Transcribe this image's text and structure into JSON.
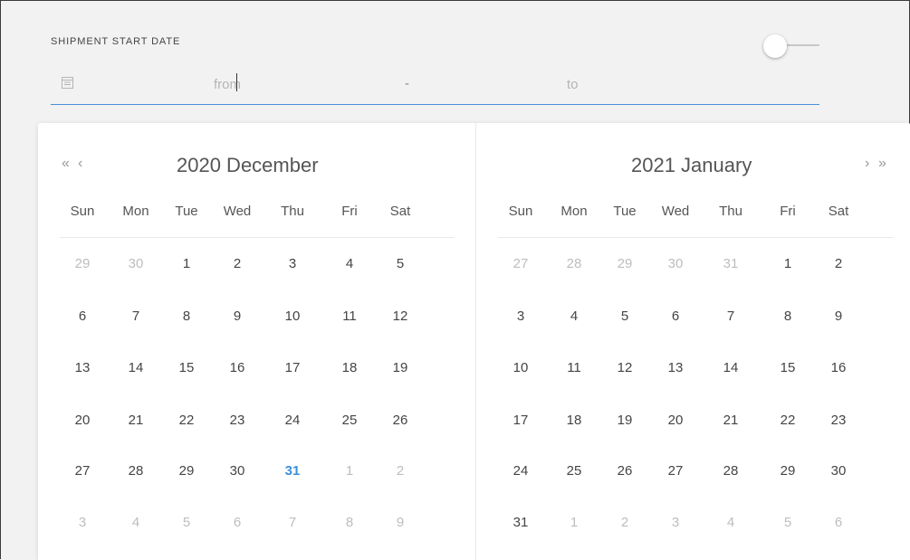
{
  "field": {
    "label": "SHIPMENT START DATE",
    "from_placeholder": "from",
    "separator": "-",
    "to_placeholder": "to"
  },
  "weekdays": [
    "Sun",
    "Mon",
    "Tue",
    "Wed",
    "Thu",
    "Fri",
    "Sat"
  ],
  "nav": {
    "prev_year": "«",
    "prev_month": "‹",
    "next_month": "›",
    "next_year": "»"
  },
  "calendars": [
    {
      "title": "2020 December",
      "weeks": [
        [
          {
            "d": "29",
            "m": true
          },
          {
            "d": "30",
            "m": true
          },
          {
            "d": "1"
          },
          {
            "d": "2"
          },
          {
            "d": "3"
          },
          {
            "d": "4"
          },
          {
            "d": "5"
          }
        ],
        [
          {
            "d": "6"
          },
          {
            "d": "7"
          },
          {
            "d": "8"
          },
          {
            "d": "9"
          },
          {
            "d": "10"
          },
          {
            "d": "11"
          },
          {
            "d": "12"
          }
        ],
        [
          {
            "d": "13"
          },
          {
            "d": "14"
          },
          {
            "d": "15"
          },
          {
            "d": "16"
          },
          {
            "d": "17"
          },
          {
            "d": "18"
          },
          {
            "d": "19"
          }
        ],
        [
          {
            "d": "20"
          },
          {
            "d": "21"
          },
          {
            "d": "22"
          },
          {
            "d": "23"
          },
          {
            "d": "24"
          },
          {
            "d": "25"
          },
          {
            "d": "26"
          }
        ],
        [
          {
            "d": "27"
          },
          {
            "d": "28"
          },
          {
            "d": "29"
          },
          {
            "d": "30"
          },
          {
            "d": "31",
            "t": true
          },
          {
            "d": "1",
            "m": true
          },
          {
            "d": "2",
            "m": true
          }
        ],
        [
          {
            "d": "3",
            "m": true
          },
          {
            "d": "4",
            "m": true
          },
          {
            "d": "5",
            "m": true
          },
          {
            "d": "6",
            "m": true
          },
          {
            "d": "7",
            "m": true
          },
          {
            "d": "8",
            "m": true
          },
          {
            "d": "9",
            "m": true
          }
        ]
      ]
    },
    {
      "title": "2021 January",
      "weeks": [
        [
          {
            "d": "27",
            "m": true
          },
          {
            "d": "28",
            "m": true
          },
          {
            "d": "29",
            "m": true
          },
          {
            "d": "30",
            "m": true
          },
          {
            "d": "31",
            "m": true
          },
          {
            "d": "1"
          },
          {
            "d": "2"
          }
        ],
        [
          {
            "d": "3"
          },
          {
            "d": "4"
          },
          {
            "d": "5"
          },
          {
            "d": "6"
          },
          {
            "d": "7"
          },
          {
            "d": "8"
          },
          {
            "d": "9"
          }
        ],
        [
          {
            "d": "10"
          },
          {
            "d": "11"
          },
          {
            "d": "12"
          },
          {
            "d": "13"
          },
          {
            "d": "14"
          },
          {
            "d": "15"
          },
          {
            "d": "16"
          }
        ],
        [
          {
            "d": "17"
          },
          {
            "d": "18"
          },
          {
            "d": "19"
          },
          {
            "d": "20"
          },
          {
            "d": "21"
          },
          {
            "d": "22"
          },
          {
            "d": "23"
          }
        ],
        [
          {
            "d": "24"
          },
          {
            "d": "25"
          },
          {
            "d": "26"
          },
          {
            "d": "27"
          },
          {
            "d": "28"
          },
          {
            "d": "29"
          },
          {
            "d": "30"
          }
        ],
        [
          {
            "d": "31"
          },
          {
            "d": "1",
            "m": true
          },
          {
            "d": "2",
            "m": true
          },
          {
            "d": "3",
            "m": true
          },
          {
            "d": "4",
            "m": true
          },
          {
            "d": "5",
            "m": true
          },
          {
            "d": "6",
            "m": true
          }
        ]
      ]
    }
  ],
  "colors": {
    "accent": "#3b8fd9",
    "muted_text": "#bdbdbd",
    "underline": "#4a90d9"
  },
  "icons": {
    "field": "calendar-icon"
  }
}
